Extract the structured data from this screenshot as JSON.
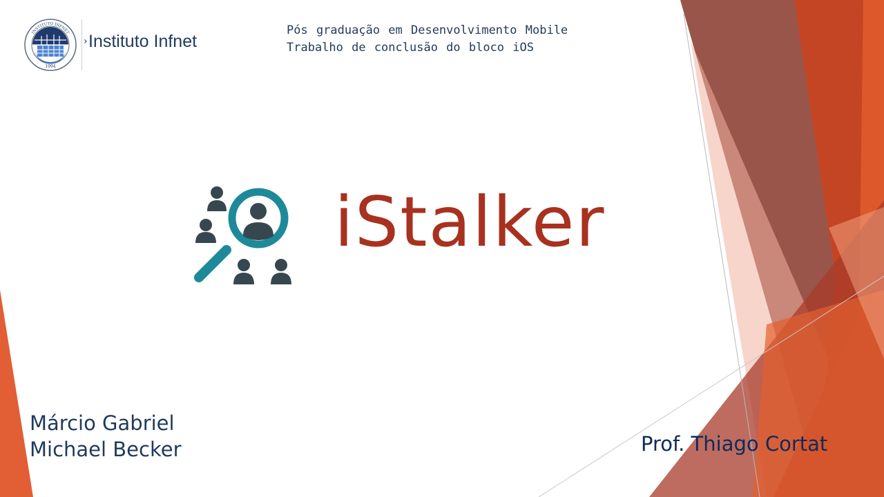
{
  "logo": {
    "name": "Instituto Infnet",
    "seal_text": "INSTITUTO INFNET",
    "seal_year": "1994"
  },
  "header": {
    "line1": "Pós graduação em Desenvolvimento Mobile",
    "line2": "Trabalho de conclusão do bloco iOS"
  },
  "app": {
    "name": "iStalker",
    "icon": "people-search-magnifier-icon"
  },
  "authors": [
    "Márcio Gabriel",
    "Michael Becker"
  ],
  "professor": "Prof. Thiago Cortat",
  "colors": {
    "title": "#a8311f",
    "text": "#1f3a5c",
    "professor": "#0f2b5c",
    "icon_teal": "#1e8a99",
    "icon_dark": "#37474f",
    "accent_orange": "#e0552a",
    "accent_brown": "#8f4336"
  }
}
